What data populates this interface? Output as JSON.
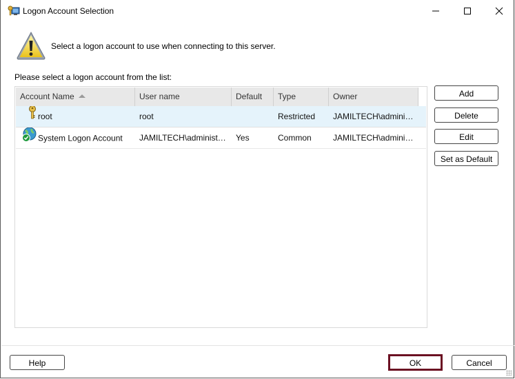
{
  "window": {
    "title": "Logon Account Selection",
    "controls": {
      "minimize": "—",
      "maximize": "☐",
      "close": "✕"
    }
  },
  "intro_text": "Select a logon account to use when connecting to this server.",
  "list_label": "Please select a logon account from the list:",
  "table": {
    "columns": [
      "Account Name",
      "User name",
      "Default",
      "Type",
      "Owner"
    ],
    "sort_column": "Account Name",
    "sort_direction": "ascending",
    "rows": [
      {
        "icon": "key-icon",
        "account_name": "root",
        "user_name": "root",
        "default": "",
        "type": "Restricted",
        "owner": "JAMILTECH\\admini…",
        "selected": true
      },
      {
        "icon": "globe-check-icon",
        "account_name": "System Logon Account",
        "user_name": "JAMILTECH\\administ…",
        "default": "Yes",
        "type": "Common",
        "owner": "JAMILTECH\\admini…",
        "selected": false
      }
    ]
  },
  "side_buttons": {
    "add": "Add",
    "delete": "Delete",
    "edit": "Edit",
    "set_default": "Set as Default"
  },
  "footer": {
    "help": "Help",
    "ok": "OK",
    "cancel": "Cancel"
  },
  "colors": {
    "selected_row": "#e5f3fb",
    "header_bg": "#e8e8e8",
    "ok_focus_border": "#6b1022"
  }
}
